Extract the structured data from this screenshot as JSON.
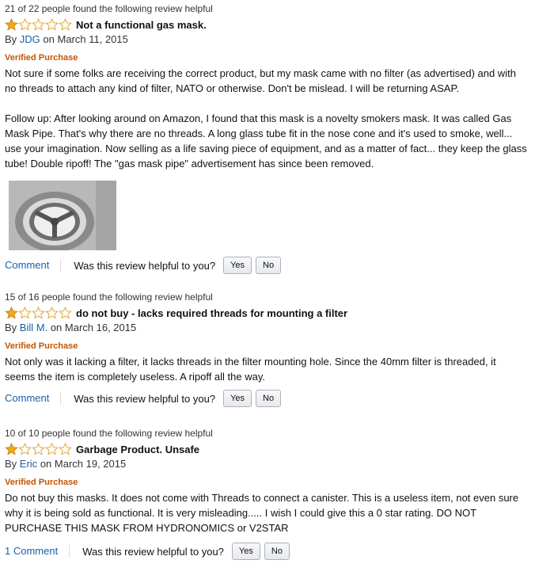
{
  "reviews": [
    {
      "helpful": "21 of 22 people found the following review helpful",
      "rating": 1,
      "title": "Not a functional gas mask.",
      "by": "By",
      "author": "JDG",
      "date": "on March 11, 2015",
      "verified": "Verified Purchase",
      "paragraphs": [
        "Not sure if some folks are receiving the correct product, but my mask came with no filter (as advertised) and with no threads to attach any kind of filter, NATO or otherwise. Don't be mislead. I will be returning ASAP.",
        "Follow up: After looking around on Amazon, I found that this mask is a novelty smokers mask. It was called Gas Mask Pipe. That's why there are no threads. A long glass tube fit in the nose cone and it's used to smoke, well... use your imagination. Now selling as a life saving piece of equipment, and as a matter of fact... they keep the glass tube! Double ripoff! The \"gas mask pipe\" advertisement has since been removed."
      ],
      "comment": "Comment",
      "question": "Was this review helpful to you?",
      "yes": "Yes",
      "no": "No"
    },
    {
      "helpful": "15 of 16 people found the following review helpful",
      "rating": 1,
      "title": "do not buy - lacks required threads for mounting a filter",
      "by": "By",
      "author": "Bill M.",
      "date": "on March 16, 2015",
      "verified": "Verified Purchase",
      "paragraphs": [
        "Not only was it lacking a filter, it lacks threads in the filter mounting hole. Since the 40mm filter is threaded, it seems the item is completely useless. A ripoff all the way."
      ],
      "comment": "Comment",
      "question": "Was this review helpful to you?",
      "yes": "Yes",
      "no": "No"
    },
    {
      "helpful": "10 of 10 people found the following review helpful",
      "rating": 1,
      "title": "Garbage Product. Unsafe",
      "by": "By",
      "author": "Eric",
      "date": "on March 19, 2015",
      "verified": "Verified Purchase",
      "paragraphs": [
        "Do not buy this masks. It does not come with Threads to connect a canister. This is a useless item, not even sure why it is being sold as functional. It is very misleading..... I wish I could give this a 0 star rating. DO NOT PURCHASE THIS MASK FROM HYDRONOMICS or V2STAR"
      ],
      "comment": "1 Comment",
      "question": "Was this review helpful to you?",
      "yes": "Yes",
      "no": "No"
    }
  ],
  "colors": {
    "link": "#1a5fa8",
    "verified": "#c45500",
    "star_fill": "#f0a820"
  },
  "icons": {
    "star_filled": "star-filled-icon",
    "star_empty": "star-empty-icon"
  }
}
